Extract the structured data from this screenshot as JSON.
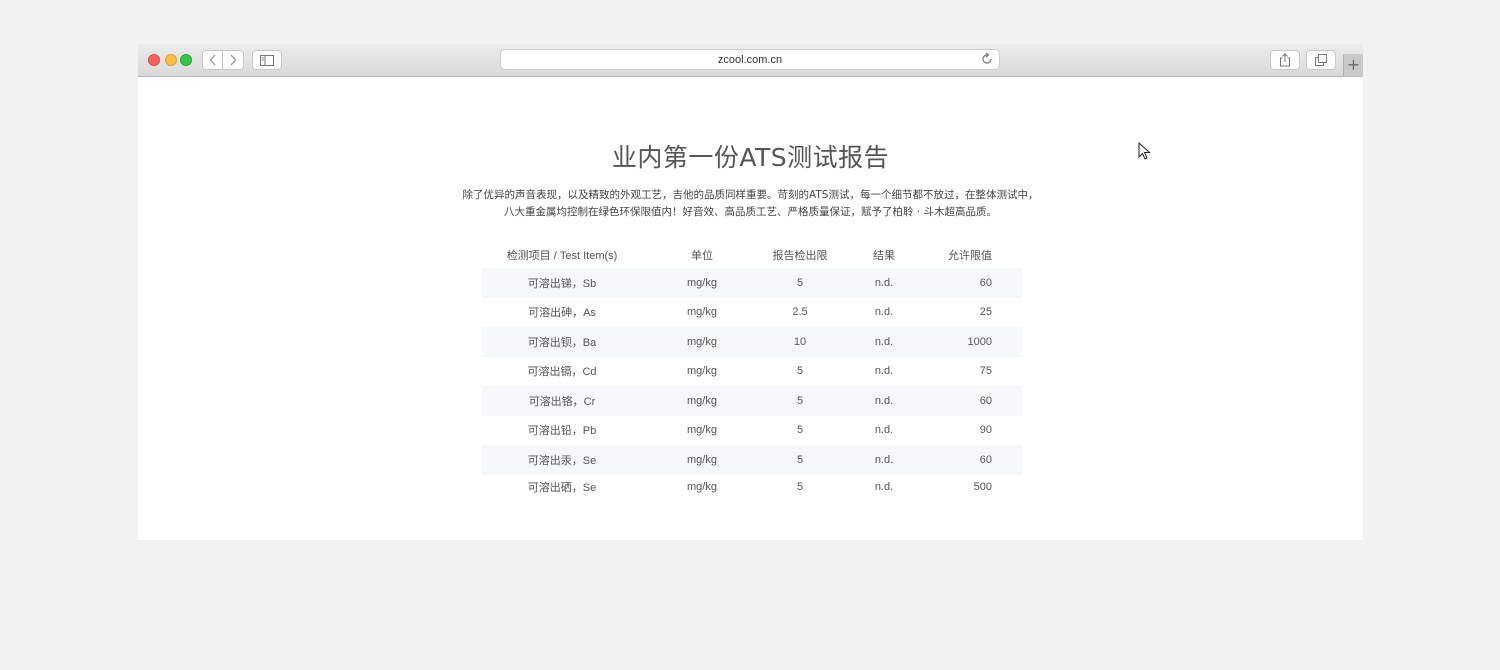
{
  "browser": {
    "url": "zcool.com.cn",
    "new_tab_label": "+"
  },
  "page": {
    "title": "业内第一份ATS测试报告",
    "intro_line1": "除了优异的声音表现，以及精致的外观工艺，吉他的品质同样重要。苛刻的ATS测试，每一个细节都不放过，在整体测试中，",
    "intro_line2": "八大重金属均控制在绿色环保限值内！好音效、高品质工艺、严格质量保证，赋予了柏聆 · 斗木超高品质。"
  },
  "table": {
    "headers": [
      "检测项目 / Test Item(s)",
      "单位",
      "报告检出限",
      "结果",
      "允许限值"
    ],
    "rows": [
      [
        "可溶出锑，Sb",
        "mg/kg",
        "5",
        "n.d.",
        "60"
      ],
      [
        "可溶出砷，As",
        "mg/kg",
        "2.5",
        "n.d.",
        "25"
      ],
      [
        "可溶出钡，Ba",
        "mg/kg",
        "10",
        "n.d.",
        "1000"
      ],
      [
        "可溶出镉，Cd",
        "mg/kg",
        "5",
        "n.d.",
        "75"
      ],
      [
        "可溶出铬，Cr",
        "mg/kg",
        "5",
        "n.d.",
        "60"
      ],
      [
        "可溶出铅，Pb",
        "mg/kg",
        "5",
        "n.d.",
        "90"
      ],
      [
        "可溶出汞，Se",
        "mg/kg",
        "5",
        "n.d.",
        "60"
      ],
      [
        "可溶出硒，Se",
        "mg/kg",
        "5",
        "n.d.",
        "500"
      ]
    ]
  },
  "icons": {
    "back": "chevron-left-icon",
    "forward": "chevron-right-icon",
    "sidebar": "sidebar-icon",
    "reload": "reload-icon",
    "share": "share-icon",
    "tabs": "tabs-icon",
    "cursor": "mouse-cursor-icon"
  },
  "colors": {
    "close": "#fc605c",
    "minimize": "#fdbc40",
    "maximize": "#34c84a",
    "row_alt": "#f6f7f9"
  }
}
